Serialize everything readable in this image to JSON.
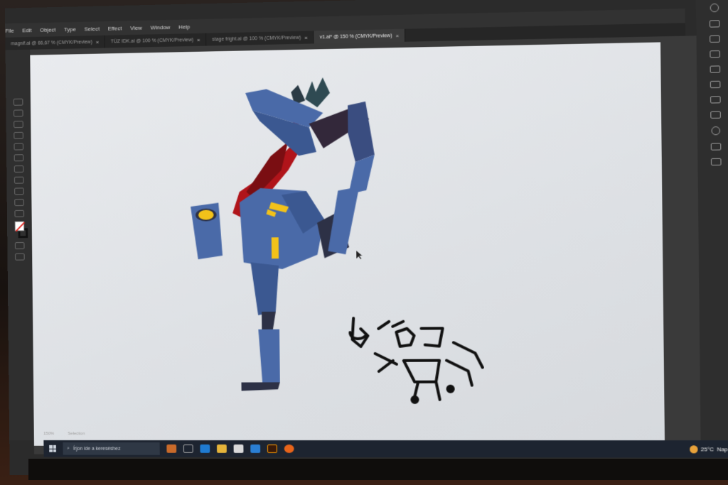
{
  "menu": [
    "File",
    "Edit",
    "Object",
    "Type",
    "Select",
    "Effect",
    "View",
    "Window",
    "Help"
  ],
  "tabs": [
    {
      "label": "magnif.ai @ 66,67 % (CMYK/Preview)",
      "active": false
    },
    {
      "label": "TÜZ IDK.ai @ 100 % (CMYK/Preview)",
      "active": false
    },
    {
      "label": "stage fright.ai @ 100 % (CMYK/Preview)",
      "active": false
    },
    {
      "label": "v1.ai* @ 150 % (CMYK/Preview)",
      "active": true
    }
  ],
  "status": {
    "zoom": "150%",
    "tool": "Selection"
  },
  "taskbar": {
    "search_placeholder": "Írjon ide a kereséshez",
    "temperature": "25°C",
    "weather_label": "Napos"
  },
  "colors": {
    "robot_blue": "#4a6aa8",
    "robot_dark": "#2d3146",
    "robot_red": "#b0141a",
    "accent_yellow": "#f2c21a",
    "artboard": "#e6e8eb"
  },
  "icons": {
    "close": "close-icon",
    "search": "search-icon",
    "start": "windows-start-icon",
    "weather": "weather-sun-icon"
  }
}
